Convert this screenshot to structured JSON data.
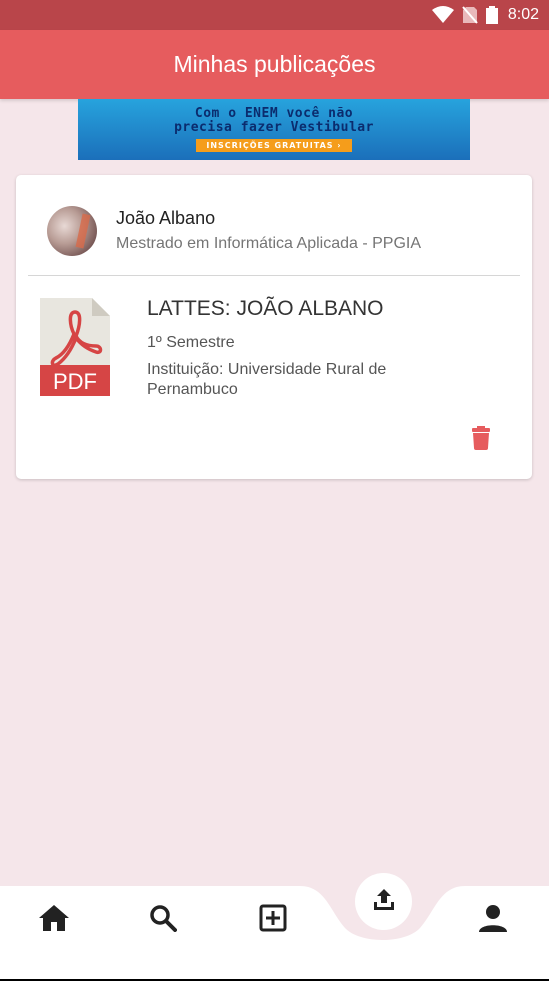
{
  "status_bar": {
    "time": "8:02",
    "icons": [
      "wifi-icon",
      "no-sim-icon",
      "battery-icon"
    ]
  },
  "app_bar": {
    "title": "Minhas publicações"
  },
  "ad": {
    "line1": "Com o ENEM você não",
    "line2": "precisa fazer Vestibular",
    "cta": "INSCRIÇÕES GRATUITAS ›"
  },
  "user": {
    "name": "João Albano",
    "course": "Mestrado em Informática Aplicada - PPGIA"
  },
  "publication": {
    "file_type": "PDF",
    "title": "LATTES: JOÃO ALBANO",
    "semester": "1º Semestre",
    "institution": "Instituição: Universidade Rural de Pernambuco"
  },
  "bottom_nav": {
    "items": [
      "home-icon",
      "search-icon",
      "add-box-icon",
      "upload-icon",
      "person-icon"
    ]
  },
  "colors": {
    "primary": "#e65c5e",
    "status_bar": "#b9454a",
    "background": "#f5e6ea",
    "delete": "#e65c5e"
  }
}
